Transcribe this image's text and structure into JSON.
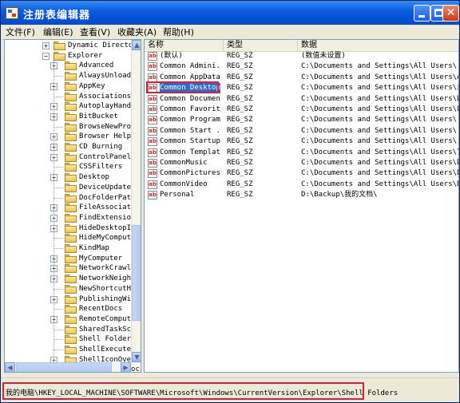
{
  "window": {
    "title": "注册表编辑器",
    "min_glyph": "",
    "max_glyph": "",
    "close_glyph": "✕"
  },
  "menu": [
    "文件(F)",
    "编辑(E)",
    "查看(V)",
    "收藏夹(A)",
    "帮助(H)"
  ],
  "tree": {
    "top_item": "Dynamic Directory",
    "parent_item": "Explorer",
    "children": [
      {
        "label": "Advanced",
        "expandable": true
      },
      {
        "label": "AlwaysUnloadDL",
        "expandable": false
      },
      {
        "label": "AppKey",
        "expandable": true
      },
      {
        "label": "Associations",
        "expandable": false
      },
      {
        "label": "AutoplayHandle",
        "expandable": true
      },
      {
        "label": "BitBucket",
        "expandable": true
      },
      {
        "label": "BrowseNewProce",
        "expandable": false
      },
      {
        "label": "Browser Helper",
        "expandable": true
      },
      {
        "label": "CD Burning",
        "expandable": true
      },
      {
        "label": "ControlPanel",
        "expandable": true
      },
      {
        "label": "CSSFilters",
        "expandable": false
      },
      {
        "label": "Desktop",
        "expandable": true
      },
      {
        "label": "DeviceUpdateLo",
        "expandable": false
      },
      {
        "label": "DocFolderPaths",
        "expandable": false
      },
      {
        "label": "FileAssociatio",
        "expandable": true
      },
      {
        "label": "FindExtensions",
        "expandable": true
      },
      {
        "label": "HideDesktopIco",
        "expandable": true
      },
      {
        "label": "HideMyComputer",
        "expandable": false
      },
      {
        "label": "KindMap",
        "expandable": false
      },
      {
        "label": "MyComputer",
        "expandable": true
      },
      {
        "label": "NetworkCrawler",
        "expandable": true
      },
      {
        "label": "NetworkNeighbo",
        "expandable": true
      },
      {
        "label": "NewShortcutHan",
        "expandable": false
      },
      {
        "label": "PublishingWiza",
        "expandable": true
      },
      {
        "label": "RecentDocs",
        "expandable": false
      },
      {
        "label": "RemoteComputer",
        "expandable": true
      },
      {
        "label": "SharedTaskSche",
        "expandable": false
      },
      {
        "label": "Shell Folders",
        "expandable": false
      },
      {
        "label": "ShellExecuteHo",
        "expandable": false
      },
      {
        "label": "ShellIconOverl",
        "expandable": true
      },
      {
        "label": "StartButtonDoc",
        "expandable": true
      }
    ]
  },
  "list": {
    "columns": [
      "名称",
      "类型",
      "数据"
    ],
    "rows": [
      {
        "name": "(默认)",
        "type": "REG_SZ",
        "data": "(数值未设置)",
        "selected": false
      },
      {
        "name": "Common Admini...",
        "type": "REG_SZ",
        "data": "C:\\Documents and Settings\\All Users\\「开始",
        "selected": false
      },
      {
        "name": "Common AppData",
        "type": "REG_SZ",
        "data": "C:\\Documents and Settings\\All Users\\Appli",
        "selected": false
      },
      {
        "name": "Common Desktop",
        "type": "REG_SZ",
        "data": "C:\\Documents and Settings\\All Users\\桌面",
        "selected": true
      },
      {
        "name": "Common Documents",
        "type": "REG_SZ",
        "data": "C:\\Documents and Settings\\All Users\\Docum",
        "selected": false
      },
      {
        "name": "Common Favorites",
        "type": "REG_SZ",
        "data": "C:\\Documents and Settings\\All Users\\Favor",
        "selected": false
      },
      {
        "name": "Common Programs",
        "type": "REG_SZ",
        "data": "C:\\Documents and Settings\\All Users\\「开始",
        "selected": false
      },
      {
        "name": "Common Start ...",
        "type": "REG_SZ",
        "data": "C:\\Documents and Settings\\All Users\\「开始",
        "selected": false
      },
      {
        "name": "Common Startup",
        "type": "REG_SZ",
        "data": "C:\\Documents and Settings\\All Users\\「开始",
        "selected": false
      },
      {
        "name": "Common Templates",
        "type": "REG_SZ",
        "data": "C:\\Documents and Settings\\All Users\\Templ",
        "selected": false
      },
      {
        "name": "CommonMusic",
        "type": "REG_SZ",
        "data": "C:\\Documents and Settings\\All Users\\Docum",
        "selected": false
      },
      {
        "name": "CommonPictures",
        "type": "REG_SZ",
        "data": "C:\\Documents and Settings\\All Users\\Docum",
        "selected": false
      },
      {
        "name": "CommonVideo",
        "type": "REG_SZ",
        "data": "C:\\Documents and Settings\\All Users\\Docum",
        "selected": false
      },
      {
        "name": "Personal",
        "type": "REG_SZ",
        "data": "D:\\Backup\\我的文档\\",
        "selected": false
      }
    ],
    "value_icon_text": "ab"
  },
  "status": {
    "path": "我的电脑\\HKEY_LOCAL_MACHINE\\SOFTWARE\\Microsoft\\Windows\\CurrentVersion\\Explorer\\Shell Folders"
  },
  "colors": {
    "title_bar": "#0a5ee0",
    "selection": "#316ac5",
    "highlight_box": "#d4203a"
  }
}
